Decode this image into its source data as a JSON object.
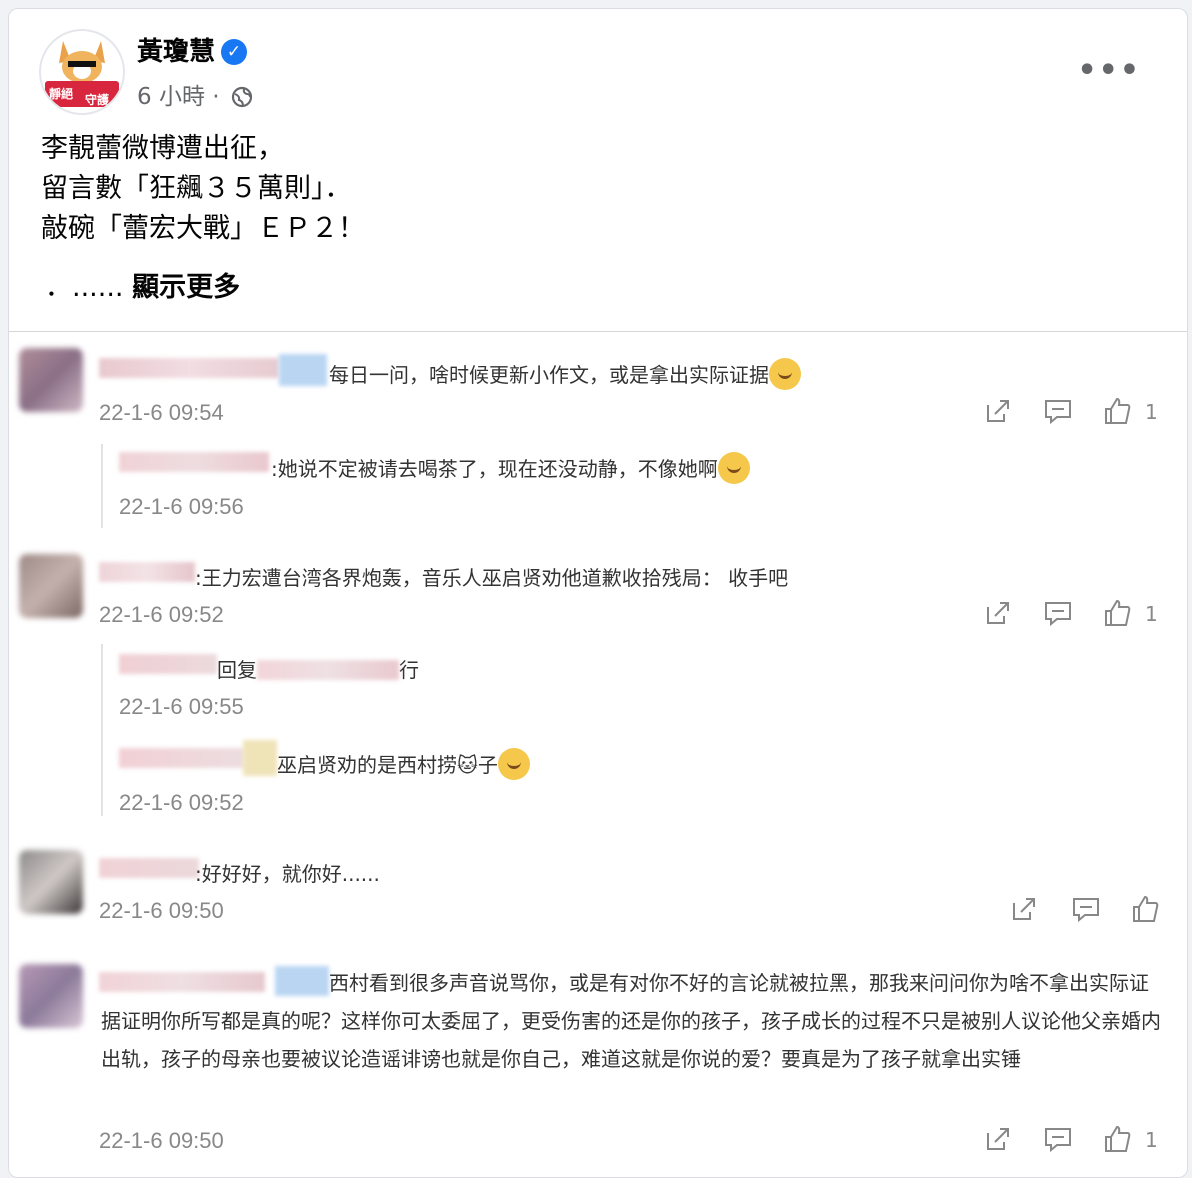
{
  "post": {
    "author": "黃瓊慧",
    "time": "6 小時 ·",
    "text": "李靚蕾微博遭出征，\n留言數「狂飆３５萬則」．\n敲碗「蕾宏大戰」ＥＰ２！",
    "see_more_prefix": "．......",
    "see_more_label": "顯示更多",
    "avatar_text_1": "靜絕",
    "avatar_text_2": "守護"
  },
  "comments": {
    "c1": {
      "text": "每日一问，啥时候更新小作文，或是拿出实际证据",
      "time": "22-1-6 09:54",
      "likes": "1"
    },
    "r1": {
      "text": ":她说不定被请去喝茶了，现在还没动静，不像她啊",
      "time": "22-1-6 09:56"
    },
    "c2": {
      "text": ":王力宏遭台湾各界炮轰，音乐人巫启贤劝他道歉收拾残局： 收手吧",
      "time": "22-1-6 09:52",
      "likes": "1"
    },
    "r2": {
      "text_a": "回复",
      "text_b": "行",
      "time": "22-1-6 09:55"
    },
    "r3": {
      "text": "巫启贤劝的是西村捞🐱子",
      "time": "22-1-6 09:52"
    },
    "c3": {
      "text": ":好好好，就你好......",
      "time": "22-1-6 09:50"
    },
    "c4": {
      "text": "西村看到很多声音说骂你，或是有对你不好的言论就被拉黑，那我来问问你为啥不拿出实际证据证明你所写都是真的呢？这样你可太委屈了，更受伤害的还是你的孩子，孩子成长的过程不只是被别人议论他父亲婚内出轨，孩子的母亲也要被议论造谣诽谤也就是你自己，难道这就是你说的爱？要真是为了孩子就拿出实锤",
      "time": "22-1-6 09:50",
      "likes": "1"
    }
  },
  "colors": {
    "verified": "#1877f2",
    "meta": "#65676b",
    "accent_red": "#d7263d"
  }
}
